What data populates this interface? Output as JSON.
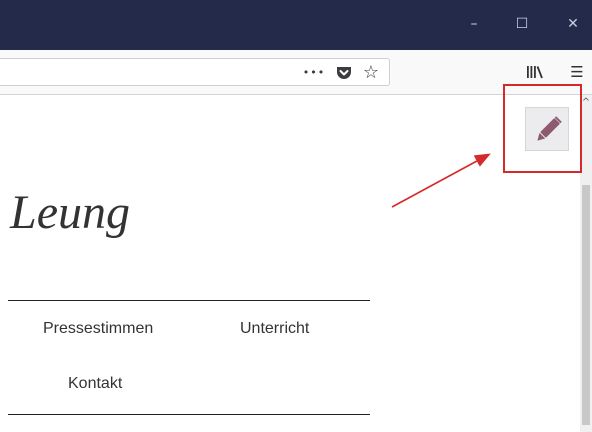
{
  "window": {
    "minimize_icon": "minimize-icon",
    "maximize_icon": "maximize-icon",
    "close_icon": "close-icon",
    "minimize_glyph": "–",
    "maximize_glyph": "☐",
    "close_glyph": "✕"
  },
  "toolbar": {
    "more_glyph": "•••",
    "pocket_icon": "pocket-icon",
    "star_glyph": "☆",
    "library_glyph": "\\",
    "menu_glyph": "☰"
  },
  "page": {
    "site_title": "Leung",
    "nav": {
      "pressestimmen": "Pressestimmen",
      "unterricht": "Unterricht",
      "kontakt": "Kontakt"
    }
  },
  "annotation": {
    "color": "#d42a2a",
    "edit_icon": "pencil-icon"
  },
  "colors": {
    "titlebar": "#232a4a",
    "toolbar": "#f9f9fa",
    "pencil": "#8c5b6f"
  }
}
